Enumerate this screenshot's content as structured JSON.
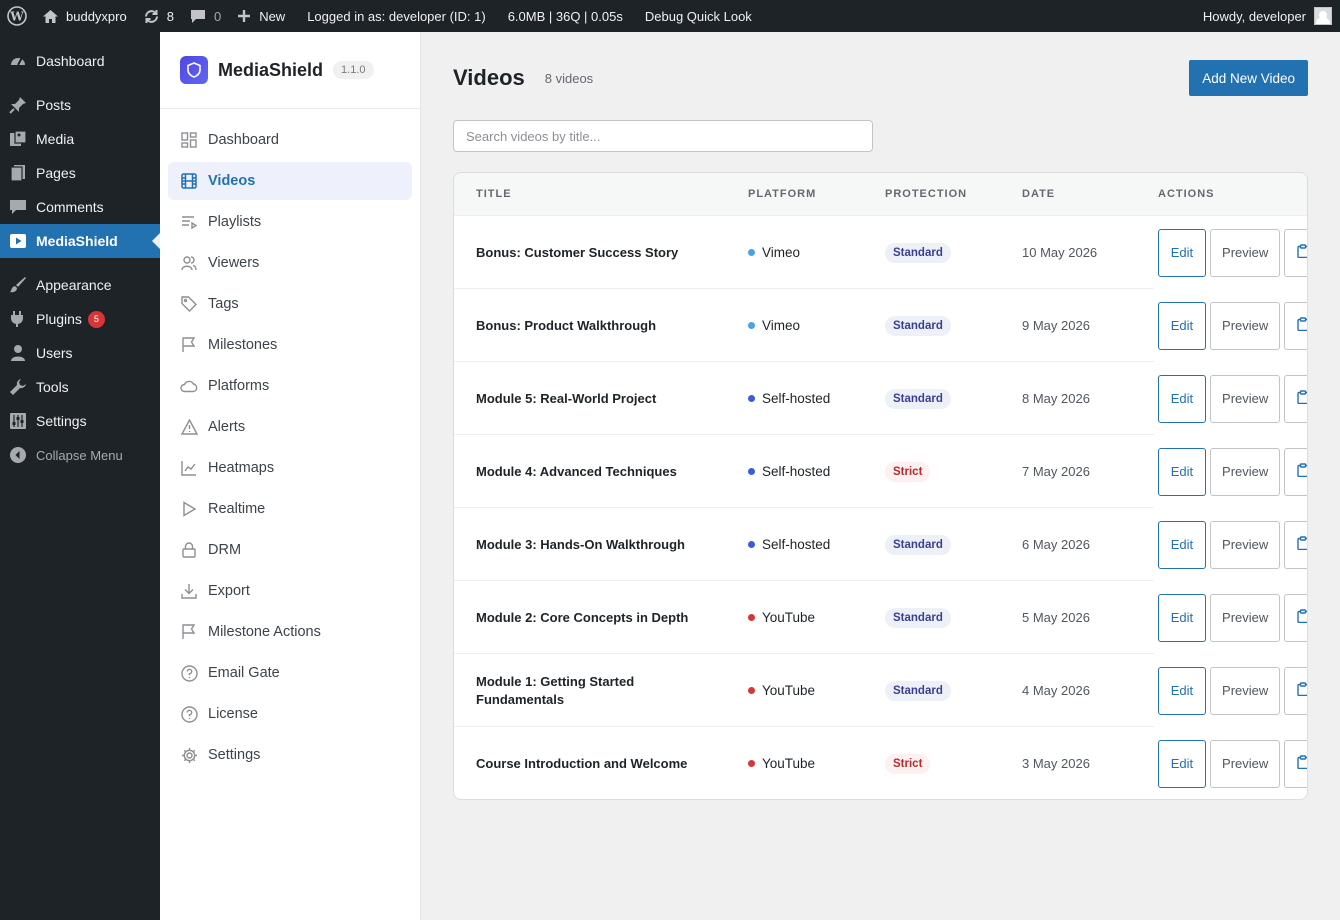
{
  "adminbar": {
    "site_name": "buddyxpro",
    "updates_count": "8",
    "comments_count": "0",
    "new_label": "New",
    "logged_in": "Logged in as: developer (ID: 1)",
    "stats": "6.0MB | 36Q | 0.05s",
    "debug": "Debug Quick Look",
    "howdy": "Howdy, developer"
  },
  "adminmenu": {
    "items": [
      {
        "label": "Dashboard",
        "icon": "dashboard-icon"
      },
      {
        "label": "Posts",
        "icon": "pin-icon"
      },
      {
        "label": "Media",
        "icon": "media-icon"
      },
      {
        "label": "Pages",
        "icon": "pages-icon"
      },
      {
        "label": "Comments",
        "icon": "comment-icon"
      },
      {
        "label": "MediaShield",
        "icon": "video-icon"
      },
      {
        "label": "Appearance",
        "icon": "brush-icon"
      },
      {
        "label": "Plugins",
        "icon": "plugin-icon",
        "badge": "5"
      },
      {
        "label": "Users",
        "icon": "user-icon"
      },
      {
        "label": "Tools",
        "icon": "wrench-icon"
      },
      {
        "label": "Settings",
        "icon": "sliders-icon"
      }
    ],
    "collapse_label": "Collapse Menu"
  },
  "plugin": {
    "name": "MediaShield",
    "version": "1.1.0",
    "nav": [
      {
        "label": "Dashboard",
        "icon": "grid-icon"
      },
      {
        "label": "Videos",
        "icon": "film-icon"
      },
      {
        "label": "Playlists",
        "icon": "playlist-icon"
      },
      {
        "label": "Viewers",
        "icon": "users-icon"
      },
      {
        "label": "Tags",
        "icon": "tag-icon"
      },
      {
        "label": "Milestones",
        "icon": "flag-icon"
      },
      {
        "label": "Platforms",
        "icon": "cloud-icon"
      },
      {
        "label": "Alerts",
        "icon": "warning-icon"
      },
      {
        "label": "Heatmaps",
        "icon": "chart-icon"
      },
      {
        "label": "Realtime",
        "icon": "play-icon"
      },
      {
        "label": "DRM",
        "icon": "lock-icon"
      },
      {
        "label": "Export",
        "icon": "download-icon"
      },
      {
        "label": "Milestone Actions",
        "icon": "flag-icon"
      },
      {
        "label": "Email Gate",
        "icon": "help-icon"
      },
      {
        "label": "License",
        "icon": "help-icon"
      },
      {
        "label": "Settings",
        "icon": "gear-icon"
      }
    ]
  },
  "page": {
    "title": "Videos",
    "count": "8 videos",
    "add_button": "Add New Video",
    "search_placeholder": "Search videos by title...",
    "columns": [
      "TITLE",
      "PLATFORM",
      "PROTECTION",
      "DATE",
      "ACTIONS"
    ],
    "edit_label": "Edit",
    "preview_label": "Preview"
  },
  "videos": [
    {
      "title": "Bonus: Customer Success Story",
      "platform": "Vimeo",
      "platform_color": "#4aa3df",
      "protection": "Standard",
      "date": "10 May 2026"
    },
    {
      "title": "Bonus: Product Walkthrough",
      "platform": "Vimeo",
      "platform_color": "#4aa3df",
      "protection": "Standard",
      "date": "9 May 2026"
    },
    {
      "title": "Module 5: Real-World Project",
      "platform": "Self-hosted",
      "platform_color": "#3b5bdb",
      "protection": "Standard",
      "date": "8 May 2026"
    },
    {
      "title": "Module 4: Advanced Techniques",
      "platform": "Self-hosted",
      "platform_color": "#3b5bdb",
      "protection": "Strict",
      "date": "7 May 2026"
    },
    {
      "title": "Module 3: Hands-On Walkthrough",
      "platform": "Self-hosted",
      "platform_color": "#3b5bdb",
      "protection": "Standard",
      "date": "6 May 2026"
    },
    {
      "title": "Module 2: Core Concepts in Depth",
      "platform": "YouTube",
      "platform_color": "#d63638",
      "protection": "Standard",
      "date": "5 May 2026"
    },
    {
      "title": "Module 1: Getting Started Fundamentals",
      "platform": "YouTube",
      "platform_color": "#d63638",
      "protection": "Standard",
      "date": "4 May 2026"
    },
    {
      "title": "Course Introduction and Welcome",
      "platform": "YouTube",
      "platform_color": "#d63638",
      "protection": "Strict",
      "date": "3 May 2026"
    }
  ],
  "colors": {
    "accent": "#2271b1",
    "admin_dark": "#1d2327"
  }
}
